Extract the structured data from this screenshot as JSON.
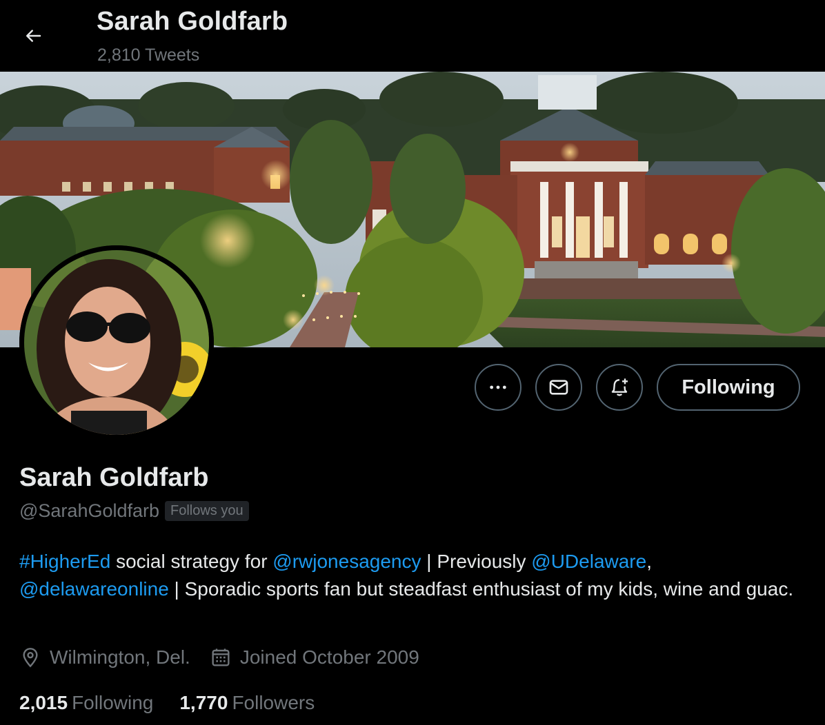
{
  "header": {
    "name": "Sarah Goldfarb",
    "tweet_count": "2,810 Tweets",
    "back_icon": "arrow-left-icon"
  },
  "banner": {
    "description_icon": "campus-banner-image"
  },
  "actions": {
    "more_icon": "more-horizontal-icon",
    "message_icon": "envelope-icon",
    "notify_icon": "bell-plus-icon",
    "following_label": "Following"
  },
  "profile": {
    "name": "Sarah Goldfarb",
    "handle": "@SarahGoldfarb",
    "follows_you": "Follows you",
    "bio": {
      "hashtag": "#HigherEd",
      "text1": " social strategy for ",
      "mention1": "@rwjonesagency",
      "text2": " | Previously ",
      "mention2": "@UDelaware",
      "text3": ", ",
      "mention3": "@delawareonline",
      "text4": " | Sporadic sports fan but steadfast enthusiast of my kids, wine and guac."
    },
    "location": "Wilmington, Del.",
    "joined": "Joined October 2009",
    "following_count": "2,015",
    "following_label": "Following",
    "followers_count": "1,770",
    "followers_label": "Followers"
  },
  "colors": {
    "background": "#000000",
    "text_primary": "#e7e9ea",
    "text_secondary": "#71767b",
    "link": "#1d9bf0",
    "border": "#536471"
  }
}
